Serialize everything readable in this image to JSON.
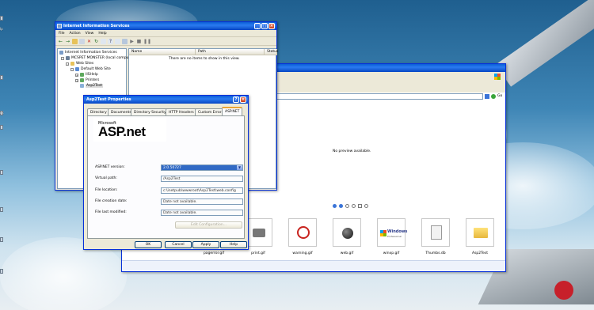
{
  "iis": {
    "title": "Internet Information Services",
    "menu": [
      "File",
      "Action",
      "View",
      "Help"
    ],
    "tree": [
      "Internet Information Services",
      "MCSPET MONSTER (local compu",
      "Web Sites",
      "Default Web Site",
      "IISHelp",
      "Printers",
      "Asp2Test"
    ],
    "columns": [
      "Name",
      "Path",
      "Status"
    ],
    "empty_message": "There are no items to show in this view."
  },
  "explorer": {
    "go_label": "Go",
    "preview_message": "No preview available.",
    "thumbnails": [
      "pagerror.gif",
      "print.gif",
      "warning.gif",
      "web.gif",
      "winxp.gif",
      "Thumbs.db",
      "Asp2Test"
    ],
    "windows_logo_text": "Windows",
    "windows_logo_sub": "Professional"
  },
  "dialog": {
    "title": "Asp2Test Properties",
    "tabs": [
      "Directory",
      "Documents",
      "Directory Security",
      "HTTP Headers",
      "Custom Errors",
      "ASP.NET"
    ],
    "logo_small": "Microsoft",
    "logo_big": "ASP.net",
    "fields": [
      {
        "label": "ASP.NET version:",
        "value": "2.0.50727"
      },
      {
        "label": "Virtual path:",
        "value": "/Asp2Test"
      },
      {
        "label": "File location:",
        "value": "c:\\inetpub\\wwwroot\\Asp2Test\\web.config"
      },
      {
        "label": "File creation date:",
        "value": "Date not available."
      },
      {
        "label": "File last modified:",
        "value": "Date not available."
      }
    ],
    "edit_config_label": "Edit Configuration...",
    "buttons": {
      "ok": "OK",
      "cancel": "Cancel",
      "apply": "Apply",
      "help": "Help"
    }
  },
  "colors": {
    "xp_blue": "#0a5fd8",
    "dialog_bg": "#ece9d8",
    "selection": "#316ac5"
  }
}
